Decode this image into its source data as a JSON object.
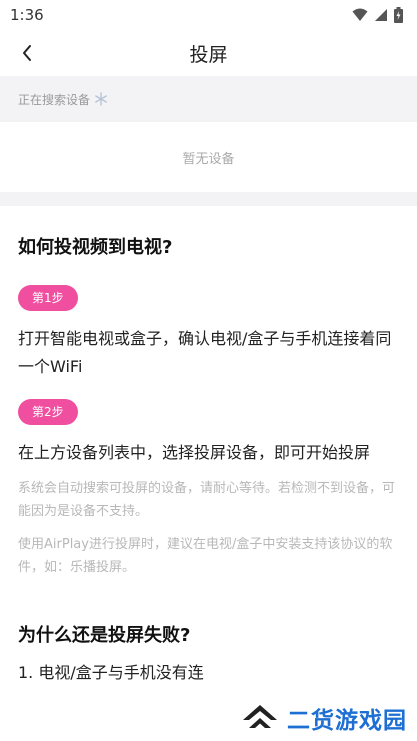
{
  "status_bar": {
    "time": "1:36",
    "icons": [
      "wifi-icon",
      "signal-icon",
      "battery-icon"
    ]
  },
  "header": {
    "title": "投屏",
    "back_icon": "chevron-left-icon"
  },
  "search": {
    "status": "正在搜索设备",
    "spinner_icon": "loading-snowflake-icon"
  },
  "devices": {
    "empty_text": "暂无设备"
  },
  "guide": {
    "title": "如何投视频到电视?",
    "steps": [
      {
        "badge": "第1步",
        "text": "打开智能电视或盒子，确认电视/盒子与手机连接着同一个WiFi"
      },
      {
        "badge": "第2步",
        "text": "在上方设备列表中，选择投屏设备，即可开始投屏"
      }
    ],
    "notes": [
      "系统会自动搜索可投屏的设备，请耐心等待。若检测不到设备，可能因为是设备不支持。",
      "使用AirPlay进行投屏时，建议在电视/盒子中安装支持该协议的软件，如：乐播投屏。"
    ]
  },
  "faq": {
    "title": "为什么还是投屏失败?",
    "item_1": "1. 电视/盒子与手机没有连"
  },
  "watermark": {
    "text": "二货游戏园",
    "color": "#1d6fd3"
  },
  "colors": {
    "accent": "#f04fa0",
    "band": "#f3f3f5"
  }
}
